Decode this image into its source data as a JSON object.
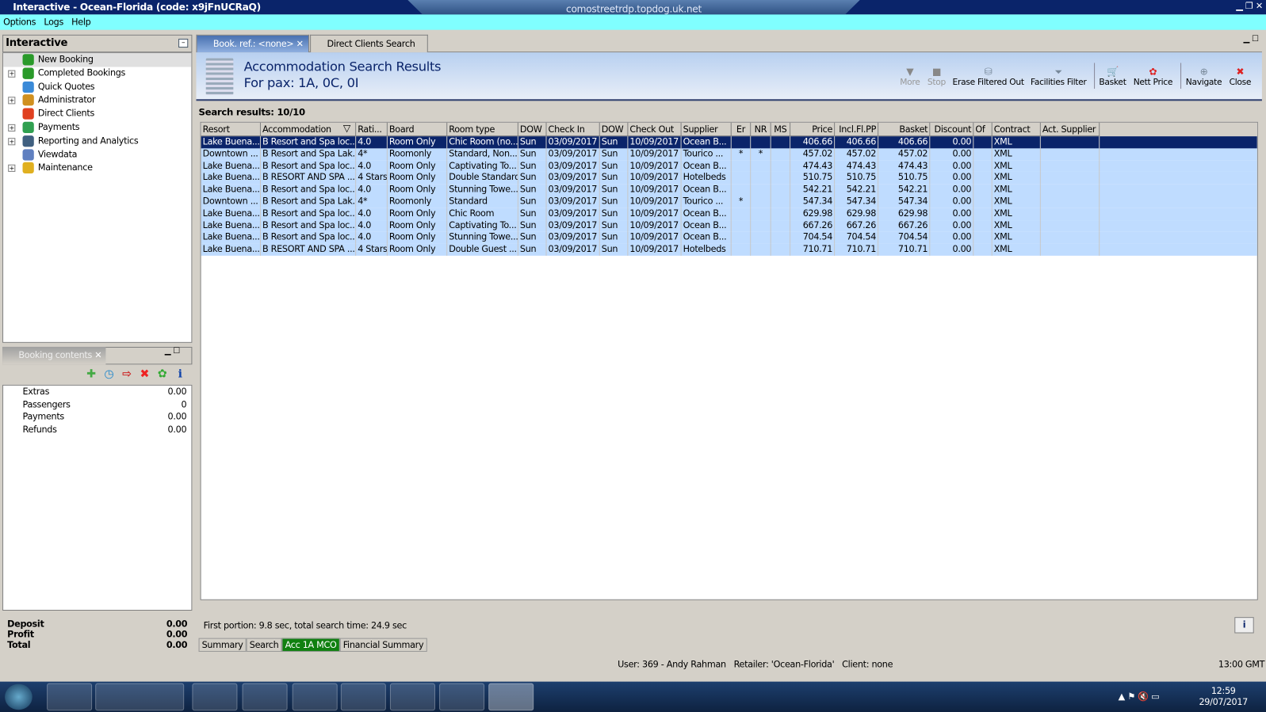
{
  "window": {
    "title": "Interactive - Ocean-Florida (code: x9jFnUCRaQ)",
    "rdp_host": "comostreetrdp.topdog.uk.net"
  },
  "menu": [
    "Options",
    "Logs",
    "Help"
  ],
  "nav": {
    "title": "Interactive",
    "items": [
      {
        "label": "New Booking",
        "expand": false,
        "color": "#2a9a2a"
      },
      {
        "label": "Completed Bookings",
        "expand": true,
        "color": "#2a9a2a"
      },
      {
        "label": "Quick Quotes",
        "expand": false,
        "color": "#3a8ad8"
      },
      {
        "label": "Administrator",
        "expand": true,
        "color": "#d09020"
      },
      {
        "label": "Direct Clients",
        "expand": false,
        "color": "#e04020"
      },
      {
        "label": "Payments",
        "expand": true,
        "color": "#30a050"
      },
      {
        "label": "Reporting and Analytics",
        "expand": true,
        "color": "#406080"
      },
      {
        "label": "Viewdata",
        "expand": false,
        "color": "#6080c0"
      },
      {
        "label": "Maintenance",
        "expand": true,
        "color": "#e0b020"
      }
    ]
  },
  "booking_contents": {
    "tab": "Booking contents",
    "rows": [
      {
        "label": "Extras",
        "value": "0.00"
      },
      {
        "label": "Passengers",
        "value": "0"
      },
      {
        "label": "Payments",
        "value": "0.00"
      },
      {
        "label": "Refunds",
        "value": "0.00"
      }
    ],
    "totals": [
      {
        "label": "Deposit",
        "value": "0.00"
      },
      {
        "label": "Profit",
        "value": "0.00"
      },
      {
        "label": "Total",
        "value": "0.00"
      }
    ]
  },
  "tabs": [
    {
      "label": "Book. ref.: <none>"
    },
    {
      "label": "Direct Clients Search"
    }
  ],
  "header": {
    "title": "Accommodation Search Results",
    "subtitle": "For pax: 1A, 0C, 0I"
  },
  "toolbar": [
    {
      "label": "More",
      "icon": "▼",
      "disabled": true
    },
    {
      "label": "Stop",
      "icon": "■",
      "disabled": true
    },
    {
      "label": "Erase Filtered Out",
      "icon": "⛁",
      "disabled": false
    },
    {
      "label": "Facilities Filter",
      "icon": "⏷",
      "disabled": false
    },
    {
      "label": "Basket",
      "icon": "🛒",
      "disabled": false
    },
    {
      "label": "Nett Price",
      "icon": "✿",
      "disabled": false
    },
    {
      "label": "Navigate",
      "icon": "⊕",
      "disabled": false
    },
    {
      "label": "Close",
      "icon": "✖",
      "disabled": false
    }
  ],
  "search_results_label": "Search results: 10/10",
  "columns": [
    "Resort",
    "Accommodation",
    "Rati...",
    "Board",
    "Room type",
    "DOW",
    "Check In",
    "DOW",
    "Check Out",
    "Supplier",
    "Er",
    "NR",
    "MS",
    "Price",
    "Incl.Fl.PP",
    "Basket",
    "Discount",
    "Of",
    "Contract",
    "Act. Supplier"
  ],
  "rows": [
    [
      "Lake Buena...",
      "B Resort and Spa loc...",
      "4.0",
      "Room Only",
      "Chic Room (no...",
      "Sun",
      "03/09/2017",
      "Sun",
      "10/09/2017",
      "Ocean B...",
      "",
      "",
      "",
      "406.66",
      "406.66",
      "406.66",
      "0.00",
      "",
      "XML",
      ""
    ],
    [
      "Downtown ...",
      "B Resort and Spa Lak...",
      "4*",
      "Roomonly",
      "Standard, Non...",
      "Sun",
      "03/09/2017",
      "Sun",
      "10/09/2017",
      "Tourico ...",
      "*",
      "*",
      "",
      "457.02",
      "457.02",
      "457.02",
      "0.00",
      "",
      "XML",
      ""
    ],
    [
      "Lake Buena...",
      "B Resort and Spa loc...",
      "4.0",
      "Room Only",
      "Captivating To...",
      "Sun",
      "03/09/2017",
      "Sun",
      "10/09/2017",
      "Ocean B...",
      "",
      "",
      "",
      "474.43",
      "474.43",
      "474.43",
      "0.00",
      "",
      "XML",
      ""
    ],
    [
      "Lake Buena...",
      "B RESORT AND SPA ...",
      "4 Stars",
      "Room Only",
      "Double Standard",
      "Sun",
      "03/09/2017",
      "Sun",
      "10/09/2017",
      "Hotelbeds",
      "",
      "",
      "",
      "510.75",
      "510.75",
      "510.75",
      "0.00",
      "",
      "XML",
      ""
    ],
    [
      "Lake Buena...",
      "B Resort and Spa loc...",
      "4.0",
      "Room Only",
      "Stunning Towe...",
      "Sun",
      "03/09/2017",
      "Sun",
      "10/09/2017",
      "Ocean B...",
      "",
      "",
      "",
      "542.21",
      "542.21",
      "542.21",
      "0.00",
      "",
      "XML",
      ""
    ],
    [
      "Downtown ...",
      "B Resort and Spa Lak...",
      "4*",
      "Roomonly",
      "Standard",
      "Sun",
      "03/09/2017",
      "Sun",
      "10/09/2017",
      "Tourico ...",
      "*",
      "",
      "",
      "547.34",
      "547.34",
      "547.34",
      "0.00",
      "",
      "XML",
      ""
    ],
    [
      "Lake Buena...",
      "B Resort and Spa loc...",
      "4.0",
      "Room Only",
      "Chic Room",
      "Sun",
      "03/09/2017",
      "Sun",
      "10/09/2017",
      "Ocean B...",
      "",
      "",
      "",
      "629.98",
      "629.98",
      "629.98",
      "0.00",
      "",
      "XML",
      ""
    ],
    [
      "Lake Buena...",
      "B Resort and Spa loc...",
      "4.0",
      "Room Only",
      "Captivating To...",
      "Sun",
      "03/09/2017",
      "Sun",
      "10/09/2017",
      "Ocean B...",
      "",
      "",
      "",
      "667.26",
      "667.26",
      "667.26",
      "0.00",
      "",
      "XML",
      ""
    ],
    [
      "Lake Buena...",
      "B Resort and Spa loc...",
      "4.0",
      "Room Only",
      "Stunning Towe...",
      "Sun",
      "03/09/2017",
      "Sun",
      "10/09/2017",
      "Ocean B...",
      "",
      "",
      "",
      "704.54",
      "704.54",
      "704.54",
      "0.00",
      "",
      "XML",
      ""
    ],
    [
      "Lake Buena...",
      "B RESORT AND SPA ...",
      "4 Stars",
      "Room Only",
      "Double Guest ...",
      "Sun",
      "03/09/2017",
      "Sun",
      "10/09/2017",
      "Hotelbeds",
      "",
      "",
      "",
      "710.71",
      "710.71",
      "710.71",
      "0.00",
      "",
      "XML",
      ""
    ]
  ],
  "selected_row": 0,
  "status": "First portion: 9.8 sec, total search time: 24.9 sec",
  "bottom_tabs": [
    {
      "label": "Summary",
      "active": false
    },
    {
      "label": "Search",
      "active": false
    },
    {
      "label": "Acc 1A MCO",
      "active": true
    },
    {
      "label": "Financial Summary",
      "active": false
    }
  ],
  "userbar": "User: 369 - Andy Rahman   Retailer: 'Ocean-Florida'   Client: none",
  "gmt": "13:00 GMT",
  "clock": {
    "time": "12:59",
    "date": "29/07/2017"
  }
}
